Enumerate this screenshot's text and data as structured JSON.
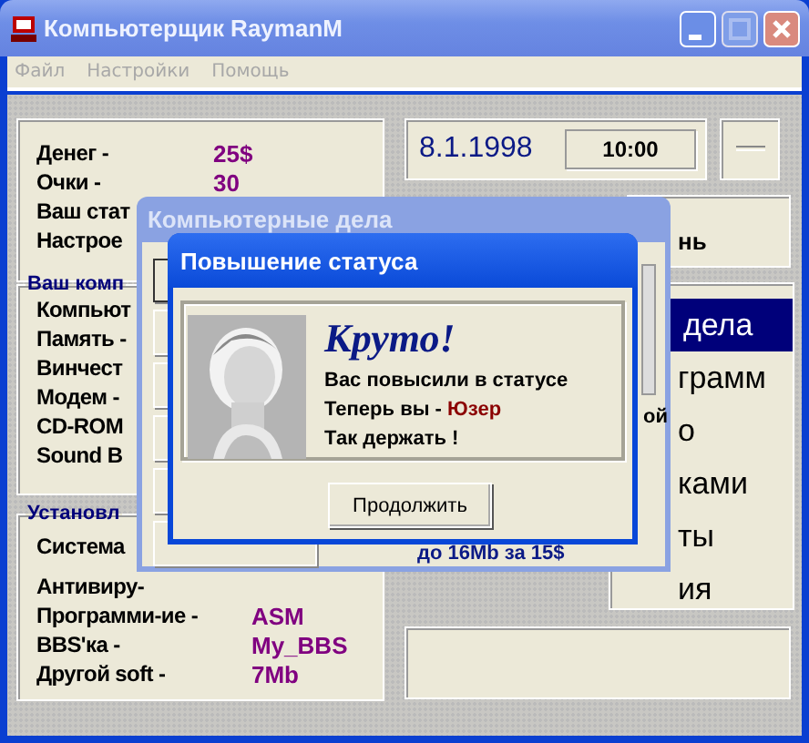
{
  "window": {
    "title": "Компьютерщик RaymanM"
  },
  "menu": [
    "Файл",
    "Настройки",
    "Помощь"
  ],
  "stats": [
    {
      "label": "Денег -",
      "value": "25$"
    },
    {
      "label": "Очки -",
      "value": "30"
    },
    {
      "label": "Ваш стат"
    },
    {
      "label": "Настрое"
    }
  ],
  "date": "8.1.1998",
  "time": "10:00",
  "side_button": "нь",
  "actions_panel": {
    "header": "дела",
    "items": [
      "грамм",
      "о",
      "ками",
      "ты",
      "ия"
    ]
  },
  "computer_group": {
    "title": "Ваш комп",
    "items": [
      "Компьют",
      "Память -",
      "Винчест",
      "Модем -",
      "CD-ROM",
      "Sound B"
    ]
  },
  "software_group": {
    "title": "Установл",
    "items": [
      {
        "label": "Система"
      },
      {
        "label": "Антивиру-"
      },
      {
        "label": "Программи-ие -",
        "value": "ASM"
      },
      {
        "label": "BBS'ка -",
        "value": "My_BBS"
      },
      {
        "label": "Другой soft -",
        "value": "7Mb"
      }
    ]
  },
  "actions_window": {
    "title": "Компьютерные дела",
    "side_text": "ой",
    "note": "до 16Mb за 15$"
  },
  "dialog": {
    "title": "Повышение статуса",
    "heading": "Круто!",
    "lines": [
      {
        "text": "Вас повысили в статусе"
      },
      {
        "text": "Теперь вы -",
        "status": "Юзер"
      },
      {
        "text": "Так держать !"
      }
    ],
    "button": "Продолжить"
  }
}
